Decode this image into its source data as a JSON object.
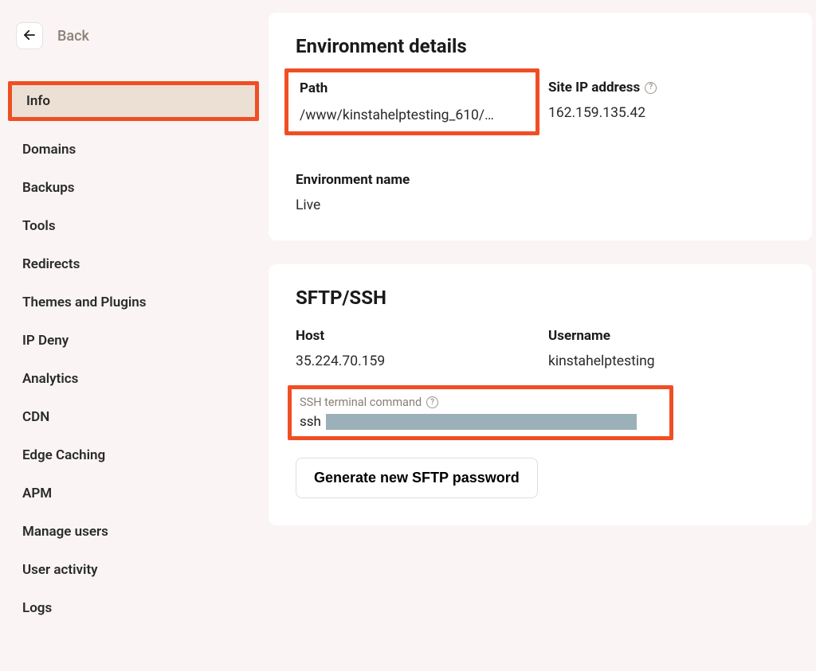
{
  "back_label": "Back",
  "sidebar": {
    "items": [
      {
        "label": "Info",
        "active": true,
        "highlighted": true
      },
      {
        "label": "Domains"
      },
      {
        "label": "Backups"
      },
      {
        "label": "Tools"
      },
      {
        "label": "Redirects"
      },
      {
        "label": "Themes and Plugins"
      },
      {
        "label": "IP Deny"
      },
      {
        "label": "Analytics"
      },
      {
        "label": "CDN"
      },
      {
        "label": "Edge Caching"
      },
      {
        "label": "APM"
      },
      {
        "label": "Manage users"
      },
      {
        "label": "User activity"
      },
      {
        "label": "Logs"
      }
    ]
  },
  "env": {
    "heading": "Environment details",
    "path_label": "Path",
    "path_value": "/www/kinstahelptesting_610/…",
    "ip_label": "Site IP address",
    "ip_value": "162.159.135.42",
    "name_label": "Environment name",
    "name_value": "Live"
  },
  "sftp": {
    "heading": "SFTP/SSH",
    "host_label": "Host",
    "host_value": "35.224.70.159",
    "user_label": "Username",
    "user_value": "kinstahelptesting",
    "ssh_cmd_label": "SSH terminal command",
    "ssh_prefix": "ssh",
    "gen_btn": "Generate new SFTP password"
  }
}
